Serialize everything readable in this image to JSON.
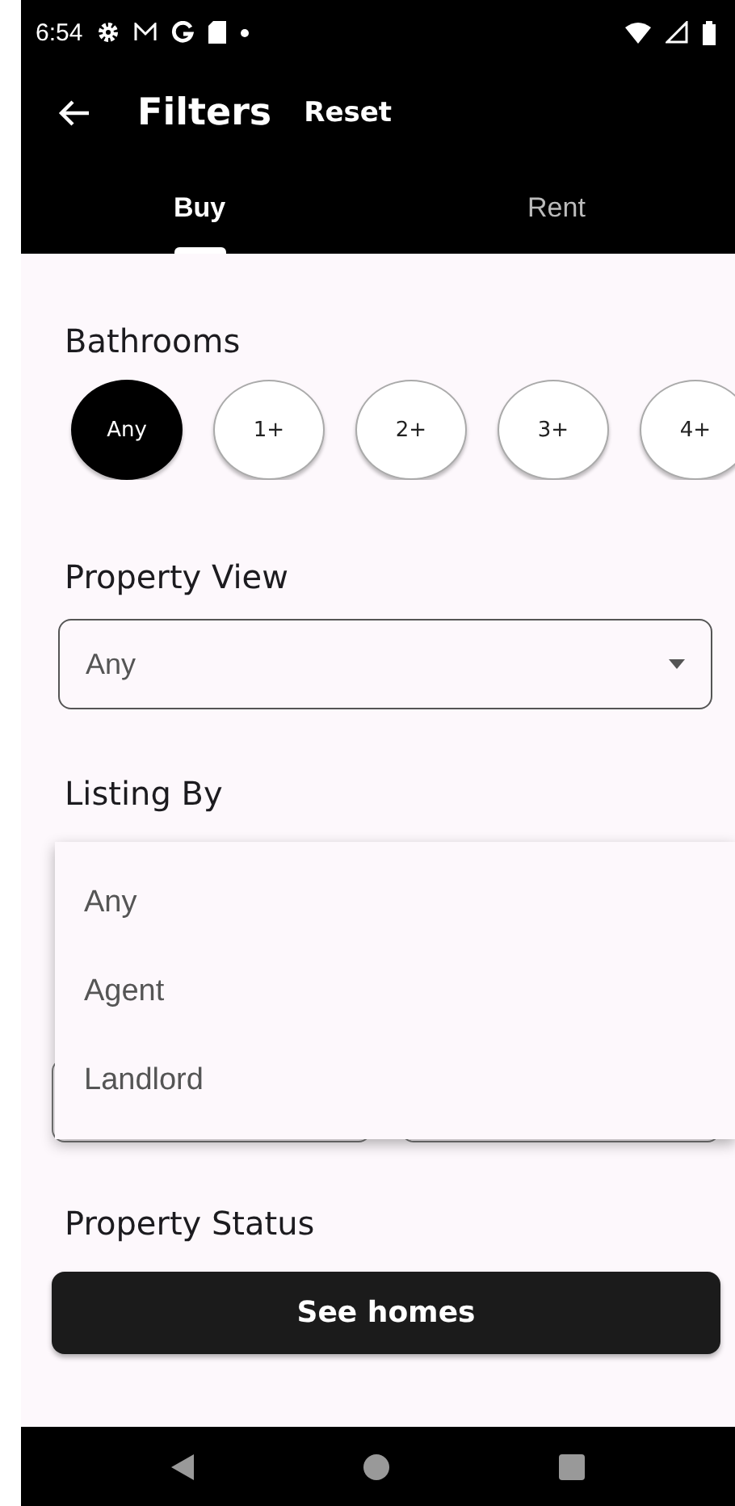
{
  "status_bar": {
    "time": "6:54"
  },
  "app_bar": {
    "title": "Filters",
    "action": "Reset"
  },
  "tabs": [
    {
      "label": "Buy",
      "selected": true
    },
    {
      "label": "Rent",
      "selected": false
    }
  ],
  "bathrooms": {
    "title": "Bathrooms",
    "options": [
      {
        "label": "Any",
        "selected": true
      },
      {
        "label": "1+",
        "selected": false
      },
      {
        "label": "2+",
        "selected": false
      },
      {
        "label": "3+",
        "selected": false
      },
      {
        "label": "4+",
        "selected": false
      }
    ]
  },
  "property_view": {
    "title": "Property View",
    "value": "Any"
  },
  "listing_by": {
    "title": "Listing By",
    "menu_items": [
      "Any",
      "Agent",
      "Landlord"
    ]
  },
  "property_status": {
    "title": "Property Status"
  },
  "primary_button": "See homes"
}
